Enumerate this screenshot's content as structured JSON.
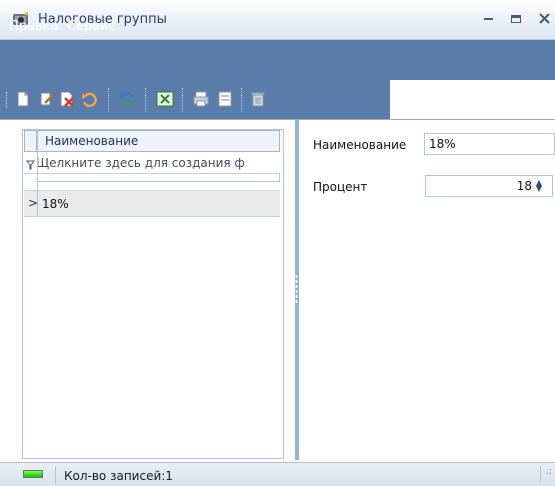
{
  "window": {
    "title": "Налоговые группы"
  },
  "menu": {
    "items": [
      "Правка",
      "Сервис"
    ]
  },
  "toolbar": {
    "icons": [
      "new-document-icon",
      "edit-icon",
      "delete-icon",
      "undo-icon",
      "refresh-icon",
      "export-excel-icon",
      "print-icon",
      "print-preview-icon",
      "trash-icon"
    ]
  },
  "grid": {
    "column_header": "Наименование",
    "filter_placeholder": "Щелкните здесь для создания ф",
    "rows": [
      {
        "indicator": ">",
        "name": "18%"
      }
    ]
  },
  "form": {
    "name_label": "Наименование",
    "name_value": "18%",
    "percent_label": "Процент",
    "percent_value": "18"
  },
  "statusbar": {
    "records_text": "Кол-во записей:1"
  },
  "colors": {
    "menubar": "#597cab",
    "titlebar": "#e9eff8",
    "splitter": "#8fb0d8",
    "selected_row": "#eaeaea"
  }
}
